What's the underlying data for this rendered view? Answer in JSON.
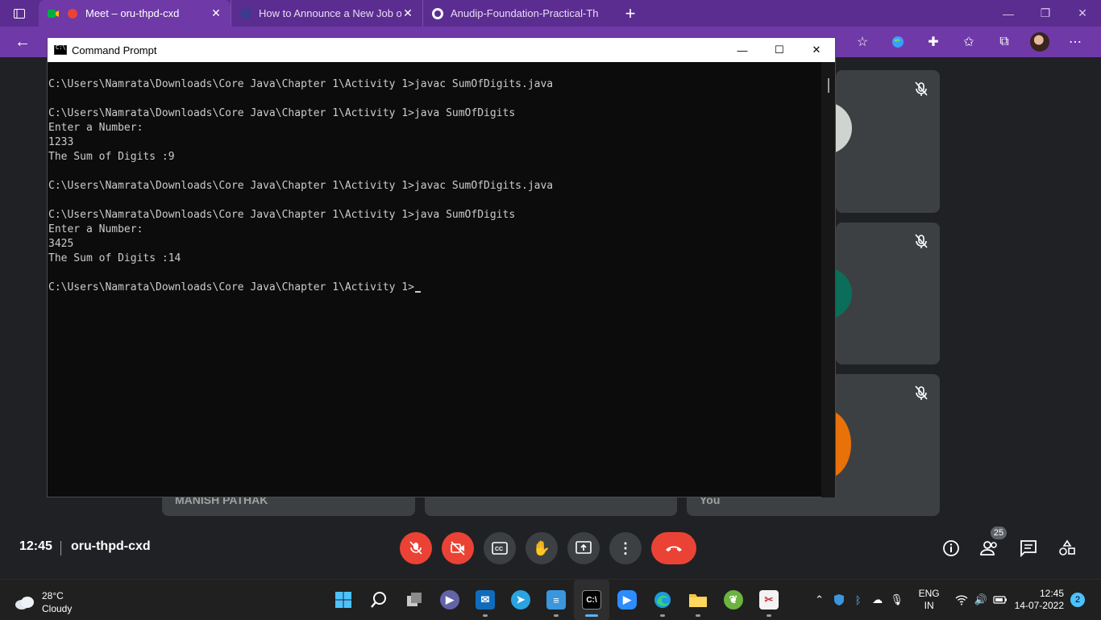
{
  "browser": {
    "tabs": [
      {
        "title": "Meet – oru-thpd-cxd",
        "active": true
      },
      {
        "title": "How to Announce a New Job on",
        "active": false
      },
      {
        "title": "Anudip-Foundation-Practical-Th",
        "active": false
      }
    ],
    "new_tab": "+",
    "close": "✕"
  },
  "meet": {
    "time": "12:45",
    "meeting_code": "oru-thpd-cxd",
    "tile_names": [
      "MANISH PATHAK",
      "You"
    ],
    "participants_count": "25"
  },
  "cmd": {
    "title": "Command Prompt",
    "lines": [
      "C:\\Users\\Namrata\\Downloads\\Core Java\\Chapter 1\\Activity 1>javac SumOfDigits.java",
      "",
      "C:\\Users\\Namrata\\Downloads\\Core Java\\Chapter 1\\Activity 1>java SumOfDigits",
      "Enter a Number:",
      "1233",
      "The Sum of Digits :9",
      "",
      "C:\\Users\\Namrata\\Downloads\\Core Java\\Chapter 1\\Activity 1>javac SumOfDigits.java",
      "",
      "C:\\Users\\Namrata\\Downloads\\Core Java\\Chapter 1\\Activity 1>java SumOfDigits",
      "Enter a Number:",
      "3425",
      "The Sum of Digits :14",
      "",
      "C:\\Users\\Namrata\\Downloads\\Core Java\\Chapter 1\\Activity 1>"
    ]
  },
  "taskbar": {
    "weather_temp": "28°C",
    "weather_desc": "Cloudy",
    "lang_top": "ENG",
    "lang_bottom": "IN",
    "clock_time": "12:45",
    "clock_date": "14-07-2022",
    "notification_count": "2"
  }
}
